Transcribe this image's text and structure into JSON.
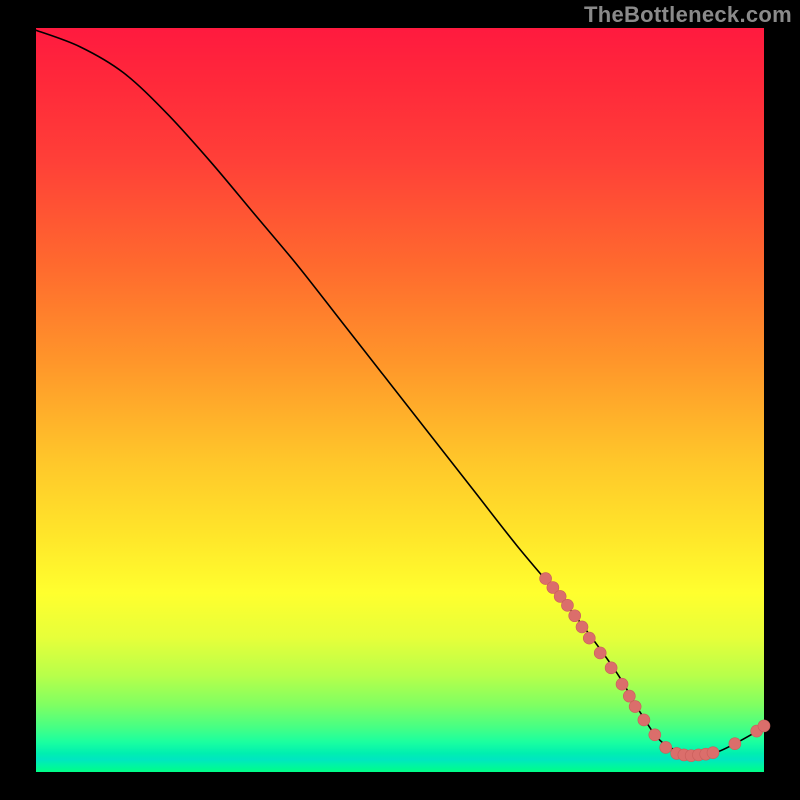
{
  "watermark": "TheBottleneck.com",
  "colors": {
    "black": "#000000",
    "marker": "#db6e6b",
    "marker_stroke": "#c95d5a",
    "watermark": "#8a8a8a"
  },
  "chart_data": {
    "type": "line",
    "title": "",
    "xlabel": "",
    "ylabel": "",
    "xlim": [
      0,
      100
    ],
    "ylim": [
      0,
      100
    ],
    "grid": false,
    "legend": false,
    "note": "No axis ticks are rendered in the source image; values are estimated on a 0–100 normalized scale where y=100 is the top (worst bottleneck, red) and y~0 is the bottom (best, green).",
    "series": [
      {
        "name": "bottleneck-curve",
        "x": [
          0,
          6,
          12,
          18,
          24,
          30,
          36,
          42,
          48,
          54,
          60,
          66,
          72,
          76,
          80,
          83,
          86,
          90,
          93,
          96,
          100
        ],
        "y": [
          99.7,
          97.5,
          94.0,
          88.5,
          82.0,
          75.0,
          68.0,
          60.5,
          53.0,
          45.5,
          38.0,
          30.5,
          23.5,
          18.5,
          13.0,
          8.0,
          4.0,
          2.3,
          2.5,
          3.8,
          6.0
        ]
      }
    ],
    "markers": [
      {
        "x": 70.0,
        "y": 26.0
      },
      {
        "x": 71.0,
        "y": 24.8
      },
      {
        "x": 72.0,
        "y": 23.6
      },
      {
        "x": 73.0,
        "y": 22.4
      },
      {
        "x": 74.0,
        "y": 21.0
      },
      {
        "x": 75.0,
        "y": 19.5
      },
      {
        "x": 76.0,
        "y": 18.0
      },
      {
        "x": 77.5,
        "y": 16.0
      },
      {
        "x": 79.0,
        "y": 14.0
      },
      {
        "x": 80.5,
        "y": 11.8
      },
      {
        "x": 81.5,
        "y": 10.2
      },
      {
        "x": 82.3,
        "y": 8.8
      },
      {
        "x": 83.5,
        "y": 7.0
      },
      {
        "x": 85.0,
        "y": 5.0
      },
      {
        "x": 86.5,
        "y": 3.3
      },
      {
        "x": 88.0,
        "y": 2.5
      },
      {
        "x": 89.0,
        "y": 2.3
      },
      {
        "x": 90.0,
        "y": 2.2
      },
      {
        "x": 91.0,
        "y": 2.3
      },
      {
        "x": 92.0,
        "y": 2.4
      },
      {
        "x": 93.0,
        "y": 2.6
      },
      {
        "x": 96.0,
        "y": 3.8
      },
      {
        "x": 99.0,
        "y": 5.5
      },
      {
        "x": 100.0,
        "y": 6.2
      }
    ],
    "marker_radius": 6
  }
}
